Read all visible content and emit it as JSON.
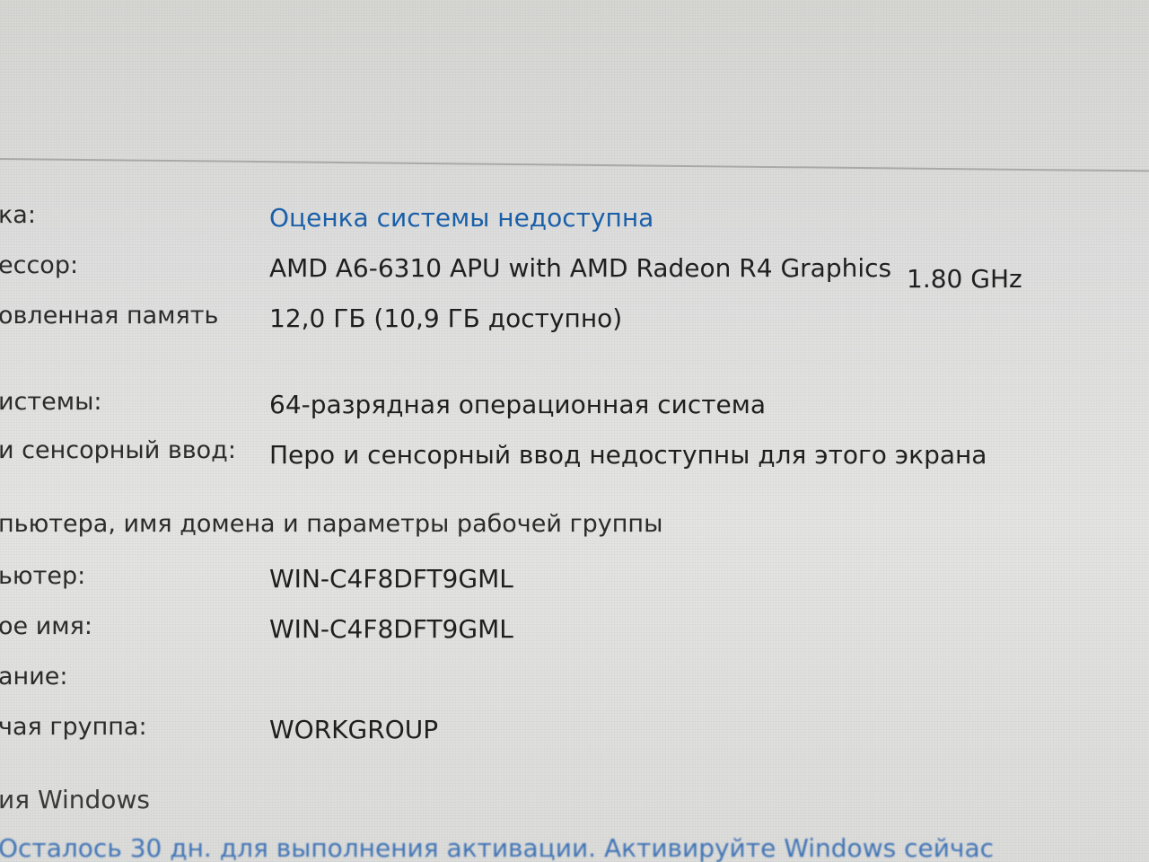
{
  "system": {
    "rating": {
      "label": "ка:",
      "value": "Оценка системы недоступна"
    },
    "processor": {
      "label": "ессор:",
      "value": "AMD A6-6310 APU with AMD Radeon R4 Graphics",
      "speed": "1.80 GHz"
    },
    "memory": {
      "label": "овленная память",
      "value": "12,0 ГБ (10,9 ГБ доступно)"
    },
    "system_type": {
      "label": "истемы:",
      "value": "64-разрядная операционная система"
    },
    "pen_touch": {
      "label": "и сенсорный ввод:",
      "value": "Перо и сенсорный ввод недоступны для этого экрана"
    }
  },
  "computer_name_section": {
    "heading": "пьютера, имя домена и параметры рабочей группы",
    "computer": {
      "label": "ьютер:",
      "value": "WIN-C4F8DFT9GML"
    },
    "full_name": {
      "label": "ое имя:",
      "value": "WIN-C4F8DFT9GML"
    },
    "description": {
      "label": "ание:",
      "value": ""
    },
    "workgroup": {
      "label": "чая группа:",
      "value": "WORKGROUP"
    }
  },
  "activation": {
    "heading": "ия Windows",
    "link": "Осталось 30 дн. для выполнения активации. Активируйте Windows сейчас"
  }
}
